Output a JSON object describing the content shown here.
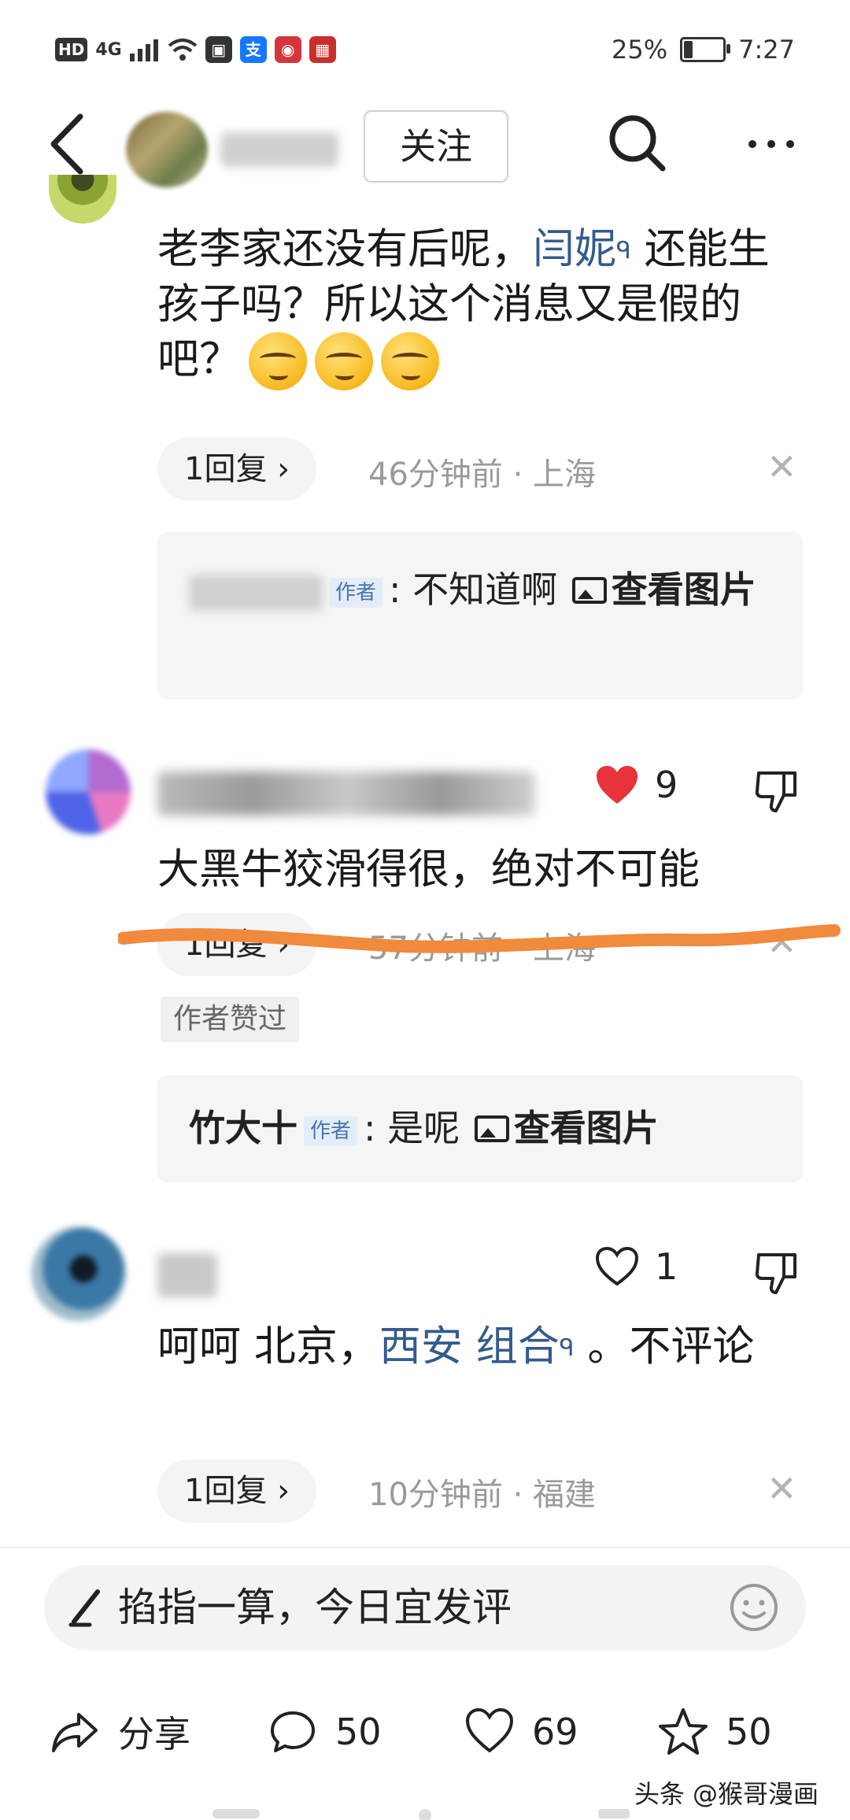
{
  "status_bar": {
    "badge_hd": "HD",
    "network": "4G",
    "battery": "25%",
    "battery_level": 0.25,
    "time": "7:27"
  },
  "header": {
    "follow_label": "关注",
    "icons": [
      "back-icon",
      "search-icon",
      "more-icon"
    ]
  },
  "comment1": {
    "text_before": "老李家还没有后呢，",
    "link": "闫妮",
    "text_after": " 还能生孩子吗？所以这个消息又是假的吧？",
    "reply_count_label": "1回复",
    "time_location": "46分钟前 · 上海",
    "reply": {
      "text": ": 不知道啊",
      "author_tag": "作者",
      "view_image": "查看图片"
    }
  },
  "comment2": {
    "text": "大黑牛狡滑得很，绝对不可能",
    "likes": "9",
    "reply_count_label": "1回复",
    "time_location": "57分钟前 · 上海",
    "approved_badge": "作者赞过",
    "reply": {
      "author": "竹大十",
      "author_tag": "作者",
      "text": ": 是呢",
      "view_image": "查看图片"
    }
  },
  "comment3": {
    "text_before": "呵呵 北京，",
    "link": "西安 组合",
    "text_after": " 。不评论",
    "likes": "1",
    "reply_count_label": "1回复",
    "time_location": "10分钟前 · 福建"
  },
  "input": {
    "placeholder": "掐指一算，今日宜发评"
  },
  "bottom_bar": {
    "share_label": "分享",
    "comments": "50",
    "likes": "69",
    "favorites": "50"
  },
  "watermark": "头条 @猴哥漫画",
  "colors": {
    "link": "#345b8c",
    "like_red": "#e8323c",
    "strike_orange": "#f08a3c"
  }
}
